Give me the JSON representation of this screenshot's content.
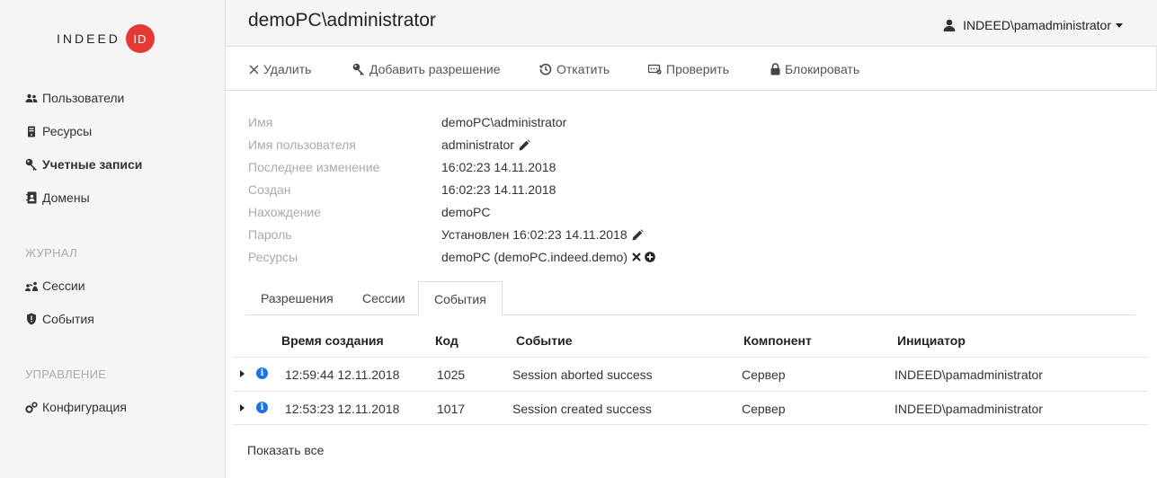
{
  "logo": {
    "text": "INDEED",
    "badge": "ID"
  },
  "sidebar": {
    "items": [
      {
        "label": "Пользователи"
      },
      {
        "label": "Ресурсы"
      },
      {
        "label": "Учетные записи"
      },
      {
        "label": "Домены"
      }
    ],
    "journal_section": "ЖУРНАЛ",
    "journal_items": [
      {
        "label": "Сессии"
      },
      {
        "label": "События"
      }
    ],
    "manage_section": "УПРАВЛЕНИЕ",
    "manage_items": [
      {
        "label": "Конфигурация"
      }
    ]
  },
  "header": {
    "title": "demoPC\\administrator",
    "user": "INDEED\\pamadministrator"
  },
  "toolbar": {
    "delete": "Удалить",
    "add_permission": "Добавить разрешение",
    "rollback": "Откатить",
    "verify": "Проверить",
    "block": "Блокировать"
  },
  "properties": [
    {
      "label": "Имя",
      "value": "demoPC\\administrator"
    },
    {
      "label": "Имя пользователя",
      "value": "administrator"
    },
    {
      "label": "Последнее изменение",
      "value": "16:02:23 14.11.2018"
    },
    {
      "label": "Создан",
      "value": "16:02:23 14.11.2018"
    },
    {
      "label": "Нахождение",
      "value": "demoPC"
    },
    {
      "label": "Пароль",
      "value": "Установлен 16:02:23 14.11.2018"
    },
    {
      "label": "Ресурсы",
      "value": "demoPC (demoPC.indeed.demo)"
    }
  ],
  "tabs": [
    {
      "label": "Разрешения"
    },
    {
      "label": "Сессии"
    },
    {
      "label": "События"
    }
  ],
  "table": {
    "headers": [
      "Время создания",
      "Код",
      "Событие",
      "Компонент",
      "Инициатор"
    ],
    "rows": [
      [
        "12:59:44 12.11.2018",
        "1025",
        "Session aborted success",
        "Сервер",
        "INDEED\\pamadministrator"
      ],
      [
        "12:53:23 12.11.2018",
        "1017",
        "Session created success",
        "Сервер",
        "INDEED\\pamadministrator"
      ]
    ]
  },
  "show_all": "Показать все",
  "colors": {
    "accent": "#e53935",
    "info": "#1a73e8",
    "sidebar_bg": "#f5f5f5"
  }
}
